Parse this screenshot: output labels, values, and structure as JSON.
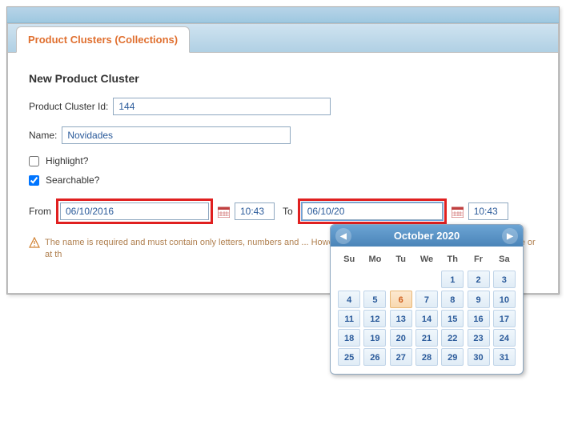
{
  "tab": {
    "label": "Product Clusters (Collections)"
  },
  "heading": "New Product Cluster",
  "fields": {
    "id_label": "Product Cluster Id:",
    "id_value": "144",
    "name_label": "Name:",
    "name_value": "Novidades",
    "highlight_label": "Highlight?",
    "searchable_label": "Searchable?",
    "from_label": "From",
    "from_date": "06/10/2016",
    "from_time": "10:43",
    "to_label": "To",
    "to_date": "06/10/20",
    "to_time": "10:43"
  },
  "warning": "The name is required and must contain only letters, numbers and ... However, the hyphen cannot be used to start the name or at th",
  "datepicker": {
    "title": "October  2020",
    "dow": [
      "Su",
      "Mo",
      "Tu",
      "We",
      "Th",
      "Fr",
      "Sa"
    ],
    "weeks": [
      [
        "",
        "",
        "",
        "",
        "1",
        "2",
        "3"
      ],
      [
        "4",
        "5",
        "6",
        "7",
        "8",
        "9",
        "10"
      ],
      [
        "11",
        "12",
        "13",
        "14",
        "15",
        "16",
        "17"
      ],
      [
        "18",
        "19",
        "20",
        "21",
        "22",
        "23",
        "24"
      ],
      [
        "25",
        "26",
        "27",
        "28",
        "29",
        "30",
        "31"
      ]
    ],
    "today": "6"
  }
}
